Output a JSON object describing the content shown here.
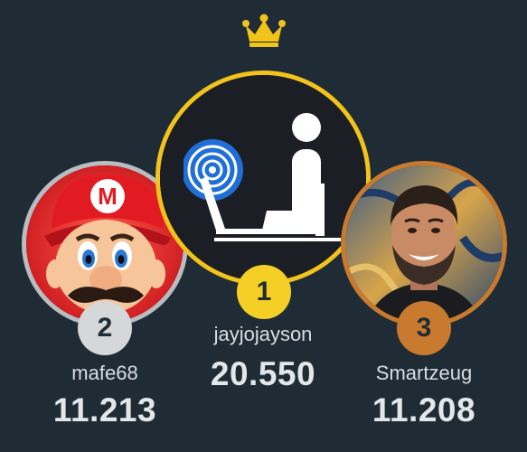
{
  "leaderboard": {
    "crown_icon": "crown-icon",
    "entries": [
      {
        "rank": "1",
        "username": "jayjojayson",
        "score": "20.550",
        "ring_color": "#f2c31b",
        "avatar": "person-at-desk-with-signal-avatar"
      },
      {
        "rank": "2",
        "username": "mafe68",
        "score": "11.213",
        "ring_color": "#b9bcc0",
        "avatar": "mario-avatar"
      },
      {
        "rank": "3",
        "username": "Smartzeug",
        "score": "11.208",
        "ring_color": "#c87a2e",
        "avatar": "bearded-man-photo-avatar"
      }
    ]
  },
  "colors": {
    "background": "#1f2c35",
    "gold": "#f4cf25",
    "silver": "#d5d7d9",
    "bronze": "#c87a2e"
  }
}
